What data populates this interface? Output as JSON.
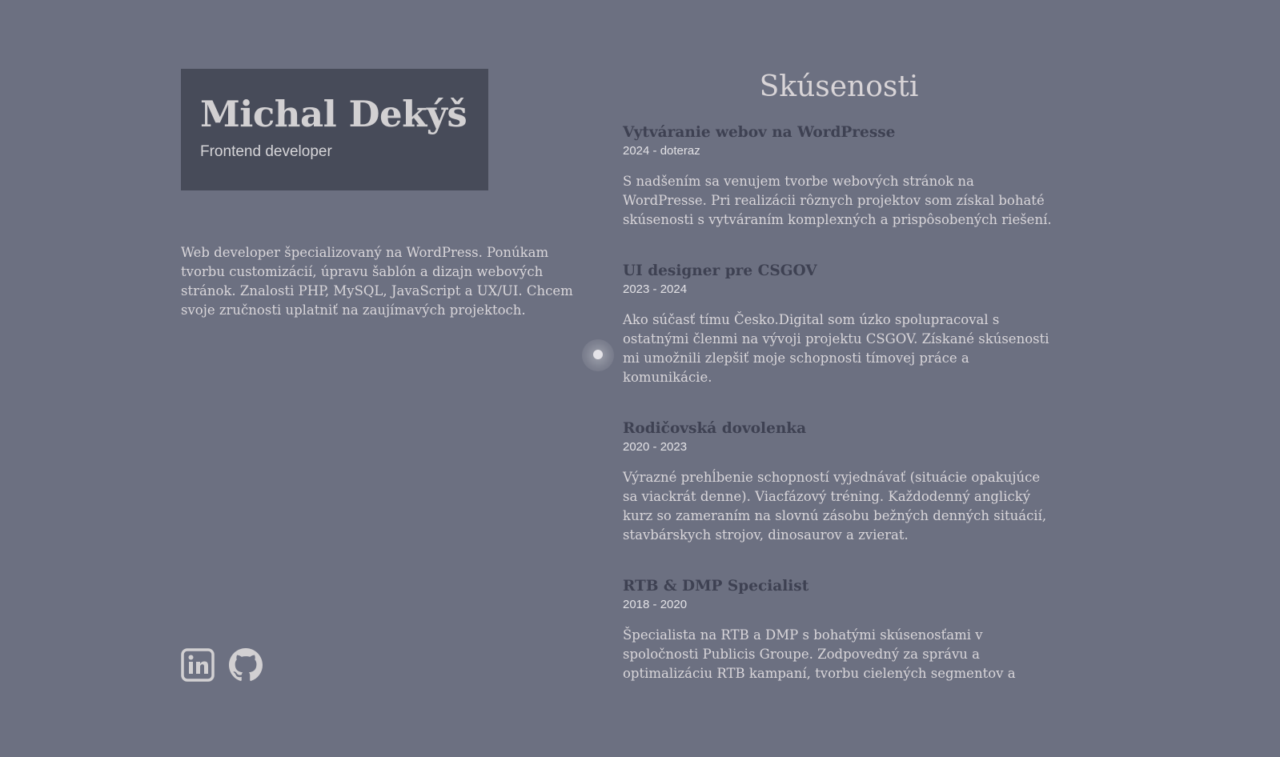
{
  "profile": {
    "name": "Michal Dekýš",
    "role": "Frontend developer",
    "bio": "Web developer špecializovaný na WordPress. Ponúkam tvorbu customizácií, úpravu šablón a dizajn webových stránok. Znalosti PHP, MySQL, JavaScript a UX/UI. Chcem svoje zručnosti uplatniť na zaujímavých projektoch."
  },
  "socials": [
    {
      "icon": "linkedin-icon"
    },
    {
      "icon": "github-icon"
    }
  ],
  "experience": {
    "title": "Skúsenosti",
    "jobs": [
      {
        "title": "Vytváranie webov na WordPresse",
        "period": "2024 - doteraz",
        "description": "S nadšením sa venujem tvorbe webových stránok na WordPresse. Pri realizácii rôznych projektov som získal bohaté skúsenosti s vytváraním komplexných a prispôsobených riešení."
      },
      {
        "title": "UI designer pre CSGOV",
        "period": "2023 - 2024",
        "description": "Ako súčasť tímu Česko.Digital som úzko spolupracoval s ostatnými členmi na vývoji projektu CSGOV. Získané skúsenosti mi umožnili zlepšiť moje schopnosti tímovej práce a komunikácie."
      },
      {
        "title": "Rodičovská dovolenka",
        "period": "2020 - 2023",
        "description": "Výrazné prehĺbenie schopností vyjednávať (situácie opakujúce sa viackrát denne). Viacfázový tréning. Každodenný anglický kurz so zameraním na slovnú zásobu bežných denných situácií, stavbárskych strojov, dinosaurov a zvierat."
      },
      {
        "title": "RTB & DMP Specialist",
        "period": "2018 - 2020",
        "description": "Špecialista na RTB a DMP s bohatými skúsenosťami v spoločnosti Publicis Groupe. Zodpovedný za správu a optimalizáciu RTB kampaní, tvorbu cielených segmentov a"
      }
    ]
  },
  "colors": {
    "background": "#6c7081",
    "card": "#474b59",
    "text_light": "#d9d6da",
    "job_title": "#3e4152"
  }
}
